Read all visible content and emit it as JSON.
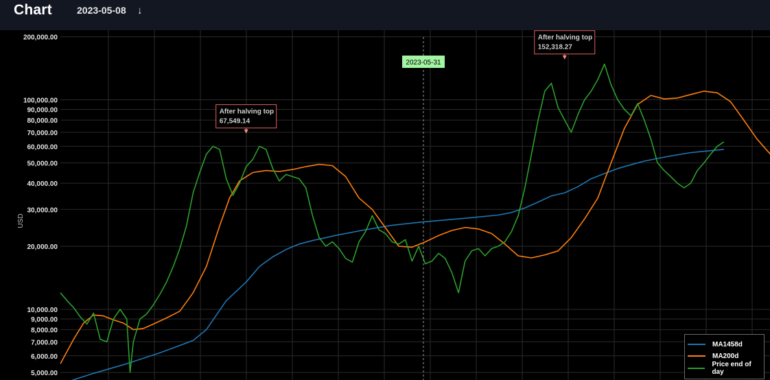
{
  "header": {
    "title": "Chart",
    "date": "2023-05-08",
    "download_icon": "arrow-down-icon"
  },
  "crosshair": {
    "date": "2023-05-31",
    "label_color": "#a3f5a3"
  },
  "annotations": [
    {
      "title": "After halving top",
      "value": "67,549.14",
      "y_value": 67549.14,
      "t": 0.28
    },
    {
      "title": "After halving top",
      "value": "152,318.27",
      "y_value": 152318.27,
      "t": 0.76
    }
  ],
  "colors": {
    "background": "#000000",
    "grid": "#2b2b2b",
    "ma1458d": "#1f77b4",
    "ma200d": "#ff7f0e",
    "price": "#2ca02c",
    "annotation_border": "#e06060"
  },
  "chart_data": {
    "type": "line",
    "title": "",
    "xlabel": "",
    "ylabel": "USD",
    "y_scale": "log",
    "ylim": [
      4600,
      215000
    ],
    "yticks": [
      {
        "value": 5000,
        "label": "5,000.00"
      },
      {
        "value": 6000,
        "label": "6,000.00"
      },
      {
        "value": 7000,
        "label": "7,000.00"
      },
      {
        "value": 8000,
        "label": "8,000.00"
      },
      {
        "value": 9000,
        "label": "9,000.00"
      },
      {
        "value": 10000,
        "label": "10,000.00"
      },
      {
        "value": 20000,
        "label": "20,000.00"
      },
      {
        "value": 30000,
        "label": "30,000.00"
      },
      {
        "value": 40000,
        "label": "40,000.00"
      },
      {
        "value": 50000,
        "label": "50,000.00"
      },
      {
        "value": 60000,
        "label": "60,000.00"
      },
      {
        "value": 70000,
        "label": "70,000.00"
      },
      {
        "value": 80000,
        "label": "80,000.00"
      },
      {
        "value": 90000,
        "label": "90,000.00"
      },
      {
        "value": 100000,
        "label": "100,000.00"
      },
      {
        "value": 200000,
        "label": "200,000.00"
      }
    ],
    "grid": true,
    "legend_position": "bottom-right",
    "series": [
      {
        "name": "MA1458d",
        "color": "#1f77b4",
        "points": [
          [
            0.0,
            4400
          ],
          [
            0.05,
            4950
          ],
          [
            0.1,
            5500
          ],
          [
            0.15,
            6200
          ],
          [
            0.2,
            7100
          ],
          [
            0.22,
            8000
          ],
          [
            0.25,
            11000
          ],
          [
            0.28,
            13500
          ],
          [
            0.3,
            16000
          ],
          [
            0.32,
            17800
          ],
          [
            0.34,
            19300
          ],
          [
            0.36,
            20500
          ],
          [
            0.38,
            21300
          ],
          [
            0.42,
            22700
          ],
          [
            0.46,
            24000
          ],
          [
            0.5,
            25200
          ],
          [
            0.54,
            26000
          ],
          [
            0.58,
            26700
          ],
          [
            0.62,
            27400
          ],
          [
            0.66,
            28200
          ],
          [
            0.68,
            29000
          ],
          [
            0.7,
            30500
          ],
          [
            0.72,
            32500
          ],
          [
            0.74,
            34800
          ],
          [
            0.76,
            36000
          ],
          [
            0.78,
            38500
          ],
          [
            0.8,
            42000
          ],
          [
            0.82,
            44500
          ],
          [
            0.84,
            47000
          ],
          [
            0.86,
            49000
          ],
          [
            0.88,
            51000
          ],
          [
            0.9,
            52500
          ],
          [
            0.92,
            54000
          ],
          [
            0.95,
            56000
          ],
          [
            1.0,
            58000
          ]
        ]
      },
      {
        "name": "MA200d",
        "color": "#ff7f0e",
        "points": [
          [
            0.0,
            5500
          ],
          [
            0.02,
            7200
          ],
          [
            0.035,
            8600
          ],
          [
            0.05,
            9400
          ],
          [
            0.065,
            9300
          ],
          [
            0.08,
            8900
          ],
          [
            0.095,
            8600
          ],
          [
            0.11,
            8000
          ],
          [
            0.125,
            8100
          ],
          [
            0.14,
            8500
          ],
          [
            0.16,
            9100
          ],
          [
            0.18,
            9800
          ],
          [
            0.2,
            12000
          ],
          [
            0.22,
            16000
          ],
          [
            0.24,
            25000
          ],
          [
            0.255,
            34000
          ],
          [
            0.27,
            41000
          ],
          [
            0.29,
            45000
          ],
          [
            0.31,
            46000
          ],
          [
            0.33,
            45500
          ],
          [
            0.35,
            46500
          ],
          [
            0.37,
            48000
          ],
          [
            0.39,
            49200
          ],
          [
            0.41,
            48500
          ],
          [
            0.43,
            43000
          ],
          [
            0.45,
            34000
          ],
          [
            0.47,
            30000
          ],
          [
            0.49,
            24500
          ],
          [
            0.51,
            20000
          ],
          [
            0.53,
            19800
          ],
          [
            0.55,
            21000
          ],
          [
            0.57,
            22500
          ],
          [
            0.59,
            23800
          ],
          [
            0.61,
            24600
          ],
          [
            0.63,
            24200
          ],
          [
            0.65,
            23000
          ],
          [
            0.67,
            20500
          ],
          [
            0.69,
            18000
          ],
          [
            0.71,
            17600
          ],
          [
            0.73,
            18200
          ],
          [
            0.75,
            19000
          ],
          [
            0.77,
            22000
          ],
          [
            0.79,
            27000
          ],
          [
            0.81,
            34000
          ],
          [
            0.83,
            50000
          ],
          [
            0.85,
            73000
          ],
          [
            0.87,
            95000
          ],
          [
            0.89,
            105000
          ],
          [
            0.91,
            101000
          ],
          [
            0.93,
            102000
          ],
          [
            0.95,
            106000
          ],
          [
            0.97,
            110000
          ],
          [
            0.99,
            108000
          ],
          [
            1.01,
            98000
          ],
          [
            1.03,
            80000
          ],
          [
            1.05,
            65000
          ],
          [
            1.07,
            55000
          ],
          [
            1.09,
            47000
          ],
          [
            1.1,
            45000
          ],
          [
            1.12,
            45500
          ],
          [
            1.14,
            47000
          ],
          [
            1.16,
            49000
          ],
          [
            1.18,
            50000
          ]
        ]
      },
      {
        "name": "Price end of day",
        "color": "#2ca02c",
        "points": [
          [
            0.0,
            12000
          ],
          [
            0.01,
            11000
          ],
          [
            0.02,
            10200
          ],
          [
            0.03,
            9200
          ],
          [
            0.04,
            8500
          ],
          [
            0.05,
            9600
          ],
          [
            0.06,
            7200
          ],
          [
            0.07,
            7000
          ],
          [
            0.08,
            9000
          ],
          [
            0.09,
            10000
          ],
          [
            0.1,
            9000
          ],
          [
            0.105,
            5000
          ],
          [
            0.11,
            7000
          ],
          [
            0.12,
            9000
          ],
          [
            0.13,
            9500
          ],
          [
            0.14,
            10500
          ],
          [
            0.15,
            11800
          ],
          [
            0.16,
            13500
          ],
          [
            0.17,
            16000
          ],
          [
            0.18,
            19500
          ],
          [
            0.19,
            25000
          ],
          [
            0.2,
            36000
          ],
          [
            0.21,
            45000
          ],
          [
            0.22,
            55000
          ],
          [
            0.23,
            60000
          ],
          [
            0.24,
            58000
          ],
          [
            0.25,
            42000
          ],
          [
            0.26,
            35000
          ],
          [
            0.27,
            40000
          ],
          [
            0.28,
            48000
          ],
          [
            0.29,
            52000
          ],
          [
            0.3,
            60000
          ],
          [
            0.31,
            58000
          ],
          [
            0.32,
            47000
          ],
          [
            0.33,
            41000
          ],
          [
            0.34,
            44000
          ],
          [
            0.35,
            43000
          ],
          [
            0.36,
            42000
          ],
          [
            0.37,
            38000
          ],
          [
            0.38,
            28000
          ],
          [
            0.39,
            22000
          ],
          [
            0.4,
            20000
          ],
          [
            0.41,
            21000
          ],
          [
            0.42,
            19500
          ],
          [
            0.43,
            17500
          ],
          [
            0.44,
            16800
          ],
          [
            0.45,
            21000
          ],
          [
            0.46,
            23500
          ],
          [
            0.47,
            28000
          ],
          [
            0.48,
            24000
          ],
          [
            0.49,
            23000
          ],
          [
            0.5,
            21000
          ],
          [
            0.51,
            20500
          ],
          [
            0.52,
            21500
          ],
          [
            0.53,
            17000
          ],
          [
            0.54,
            20000
          ],
          [
            0.55,
            16500
          ],
          [
            0.56,
            17000
          ],
          [
            0.57,
            18500
          ],
          [
            0.58,
            17500
          ],
          [
            0.59,
            15000
          ],
          [
            0.6,
            12000
          ],
          [
            0.61,
            17000
          ],
          [
            0.62,
            19000
          ],
          [
            0.63,
            19500
          ],
          [
            0.64,
            18000
          ],
          [
            0.65,
            19500
          ],
          [
            0.66,
            20000
          ],
          [
            0.67,
            21000
          ],
          [
            0.68,
            23500
          ],
          [
            0.69,
            28000
          ],
          [
            0.7,
            38000
          ],
          [
            0.71,
            55000
          ],
          [
            0.72,
            80000
          ],
          [
            0.73,
            110000
          ],
          [
            0.74,
            120000
          ],
          [
            0.75,
            92000
          ],
          [
            0.76,
            80000
          ],
          [
            0.77,
            70000
          ],
          [
            0.78,
            85000
          ],
          [
            0.79,
            100000
          ],
          [
            0.8,
            110000
          ],
          [
            0.81,
            125000
          ],
          [
            0.82,
            148000
          ],
          [
            0.83,
            118000
          ],
          [
            0.84,
            100000
          ],
          [
            0.85,
            90000
          ],
          [
            0.86,
            84000
          ],
          [
            0.87,
            96000
          ],
          [
            0.88,
            80000
          ],
          [
            0.89,
            65000
          ],
          [
            0.9,
            50000
          ],
          [
            0.91,
            46000
          ],
          [
            0.92,
            43000
          ],
          [
            0.93,
            40000
          ],
          [
            0.94,
            38000
          ],
          [
            0.95,
            40000
          ],
          [
            0.96,
            46000
          ],
          [
            0.97,
            50000
          ],
          [
            0.98,
            55000
          ],
          [
            0.99,
            60000
          ],
          [
            1.0,
            63000
          ]
        ]
      }
    ]
  }
}
